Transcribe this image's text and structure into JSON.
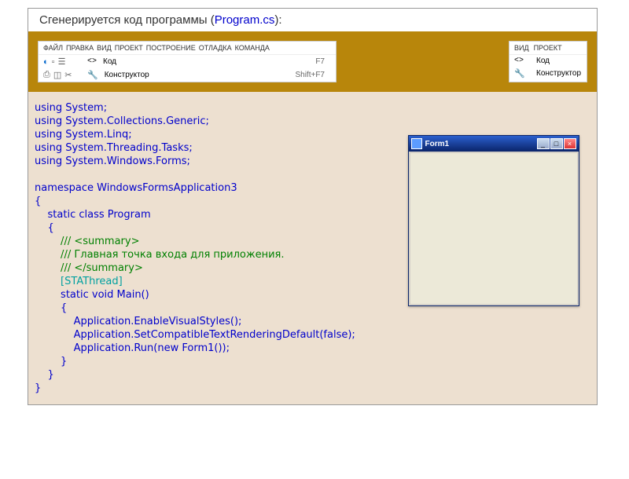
{
  "header": {
    "text_before": "Сгенерируется код программы (",
    "filename": "Program.cs",
    "text_after": "):"
  },
  "left_toolbar": {
    "menu": [
      "ФАЙЛ",
      "ПРАВКА",
      "ВИД",
      "ПРОЕКТ",
      "ПОСТРОЕНИЕ",
      "ОТЛАДКА",
      "КОМАНДА"
    ],
    "rows": [
      {
        "label": "Код",
        "shortcut": "F7"
      },
      {
        "label": "Конструктор",
        "shortcut": "Shift+F7"
      }
    ]
  },
  "right_toolbar": {
    "menu": [
      "ВИД",
      "ПРОЕКТ"
    ],
    "rows": [
      {
        "label": "Код"
      },
      {
        "label": "Конструктор"
      }
    ]
  },
  "code": {
    "usings": [
      "using System;",
      "using System.Collections.Generic;",
      "using System.Linq;",
      "using System.Threading.Tasks;",
      "using System.Windows.Forms;"
    ],
    "namespace_line": "namespace WindowsFormsApplication3",
    "brace_open": "{",
    "class_line": "    static class Program",
    "brace_open2": "    {",
    "summary_open": "        /// <summary>",
    "summary_body": "        /// Главная точка входа для приложения.",
    "summary_close": "        /// </summary>",
    "attr_line": "        [STAThread]",
    "main_line": "        static void Main()",
    "brace_open3": "        {",
    "app1": "            Application.EnableVisualStyles();",
    "app2": "            Application.SetCompatibleTextRenderingDefault(false);",
    "app3": "            Application.Run(new Form1());",
    "brace_close3": "        }",
    "brace_close2": "    }",
    "brace_close": "}"
  },
  "form_window": {
    "title": "Form1",
    "min": "_",
    "max": "□",
    "close": "×"
  }
}
